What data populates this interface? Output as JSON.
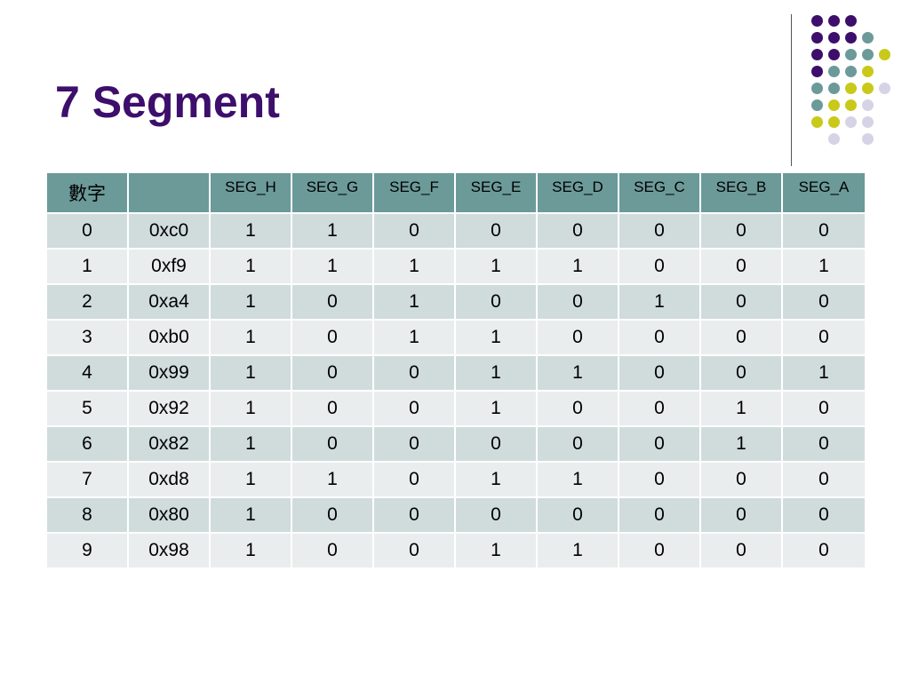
{
  "slide": {
    "title": "7 Segment"
  },
  "colors": {
    "title": "#3d0e6b",
    "header_bg": "#6b9a99",
    "row_odd_bg": "#d0dcdc",
    "row_even_bg": "#e9eded",
    "dot_purple": "#3d0e6b",
    "dot_teal": "#6b9a99",
    "dot_yellow": "#c9c91a",
    "dot_lavender": "#d6d3e6"
  },
  "table": {
    "headers": [
      "數字",
      "",
      "SEG_H",
      "SEG_G",
      "SEG_F",
      "SEG_E",
      "SEG_D",
      "SEG_C",
      "SEG_B",
      "SEG_A"
    ],
    "rows": [
      [
        "0",
        "0xc0",
        "1",
        "1",
        "0",
        "0",
        "0",
        "0",
        "0",
        "0"
      ],
      [
        "1",
        "0xf9",
        "1",
        "1",
        "1",
        "1",
        "1",
        "0",
        "0",
        "1"
      ],
      [
        "2",
        "0xa4",
        "1",
        "0",
        "1",
        "0",
        "0",
        "1",
        "0",
        "0"
      ],
      [
        "3",
        "0xb0",
        "1",
        "0",
        "1",
        "1",
        "0",
        "0",
        "0",
        "0"
      ],
      [
        "4",
        "0x99",
        "1",
        "0",
        "0",
        "1",
        "1",
        "0",
        "0",
        "1"
      ],
      [
        "5",
        "0x92",
        "1",
        "0",
        "0",
        "1",
        "0",
        "0",
        "1",
        "0"
      ],
      [
        "6",
        "0x82",
        "1",
        "0",
        "0",
        "0",
        "0",
        "0",
        "1",
        "0"
      ],
      [
        "7",
        "0xd8",
        "1",
        "1",
        "0",
        "1",
        "1",
        "0",
        "0",
        "0"
      ],
      [
        "8",
        "0x80",
        "1",
        "0",
        "0",
        "0",
        "0",
        "0",
        "0",
        "0"
      ],
      [
        "9",
        "0x98",
        "1",
        "0",
        "0",
        "1",
        "1",
        "0",
        "0",
        "0"
      ]
    ]
  }
}
